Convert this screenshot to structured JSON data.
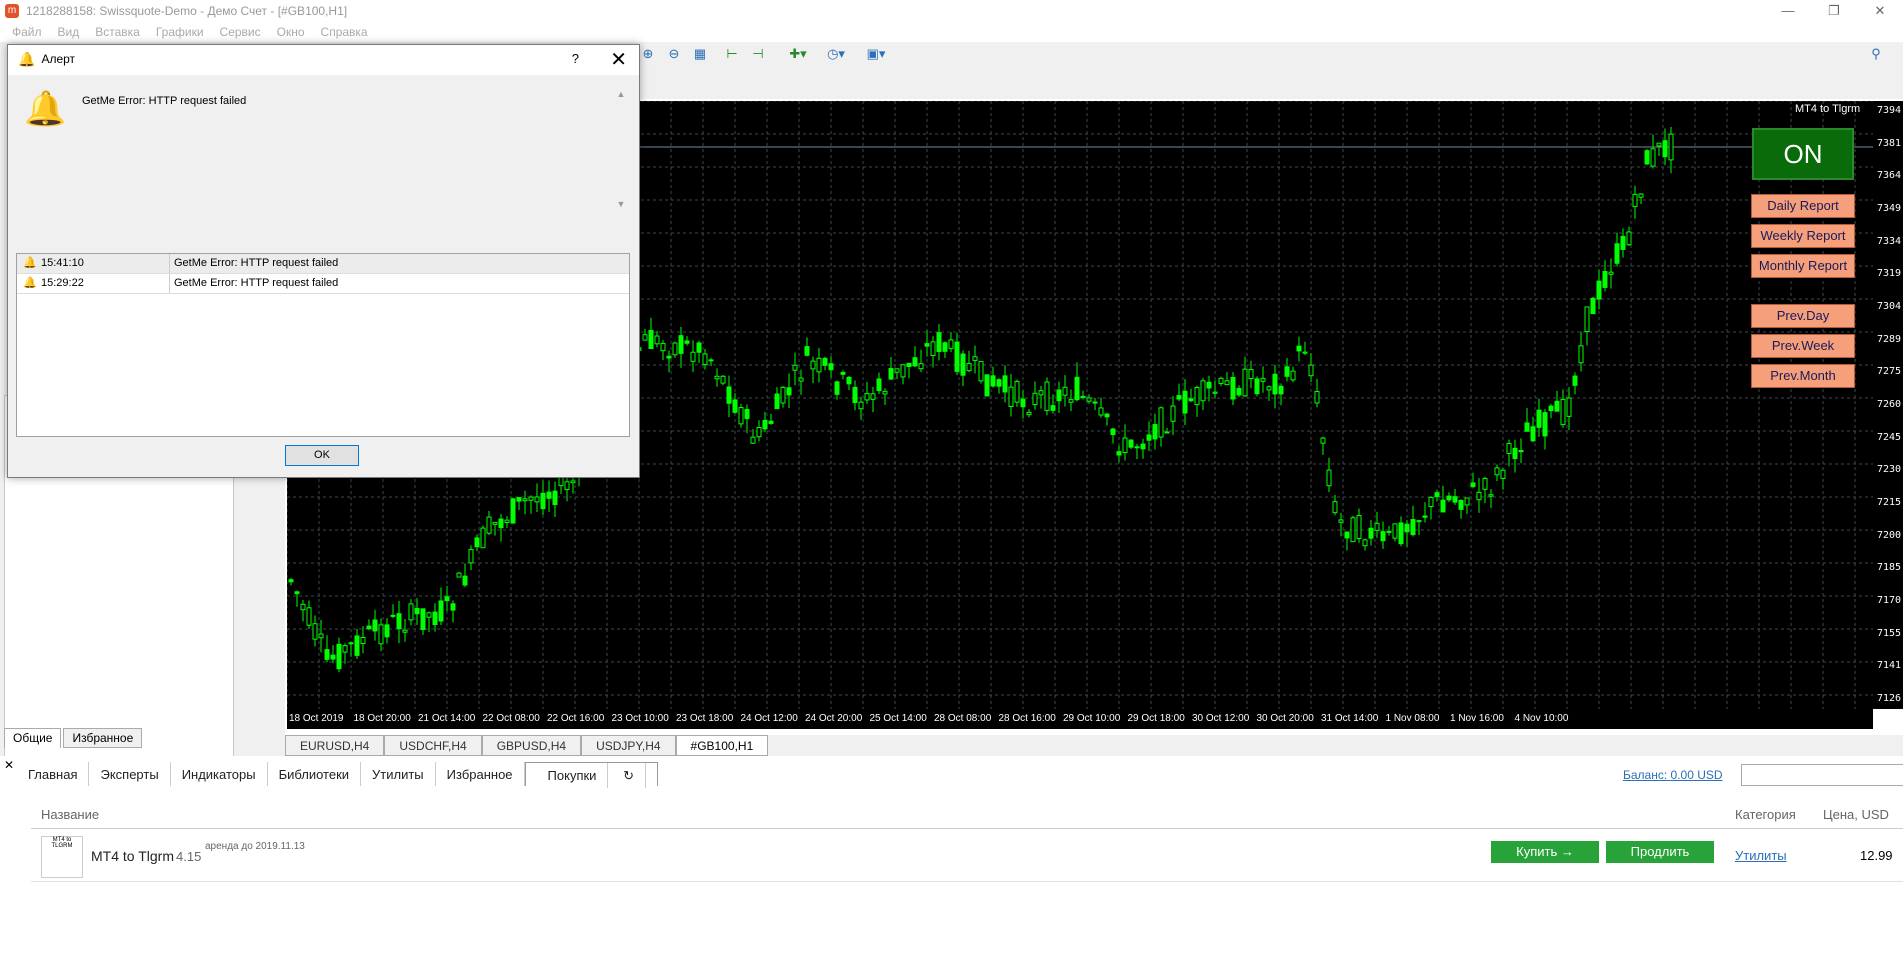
{
  "window": {
    "title": "1218288158: Swissquote-Demo - Демо Счет - [#GB100,H1]",
    "app_icon": "mt4-icon"
  },
  "menu": [
    "Файл",
    "Вид",
    "Вставка",
    "Графики",
    "Сервис",
    "Окно",
    "Справка"
  ],
  "navigator_tabs": [
    "Общие",
    "Избранное"
  ],
  "chart": {
    "ea_title": "MT4 to Tlgrm",
    "buttons": {
      "on": "ON",
      "daily": "Daily Report",
      "weekly": "Weekly Report",
      "monthly": "Monthly Report",
      "prev_day": "Prev.Day",
      "prev_week": "Prev.Week",
      "prev_month": "Prev.Month"
    },
    "price_labels": [
      "7394.3",
      "7381.2",
      "7364.0",
      "7349.0",
      "7334.0",
      "7319.0",
      "7304.0",
      "7289.0",
      "7275.0",
      "7260.0",
      "7245.0",
      "7230.0",
      "7215.0",
      "7200.0",
      "7185.0",
      "7170.0",
      "7155.0",
      "7141.0",
      "7126.0"
    ],
    "time_labels": [
      "18 Oct 2019",
      "18 Oct 20:00",
      "21 Oct 14:00",
      "22 Oct 08:00",
      "22 Oct 16:00",
      "23 Oct 10:00",
      "23 Oct 18:00",
      "24 Oct 12:00",
      "24 Oct 20:00",
      "25 Oct 14:00",
      "28 Oct 08:00",
      "28 Oct 16:00",
      "29 Oct 10:00",
      "29 Oct 18:00",
      "30 Oct 12:00",
      "30 Oct 20:00",
      "31 Oct 14:00",
      "1 Nov 08:00",
      "1 Nov 16:00",
      "4 Nov 10:00"
    ],
    "colors": {
      "background": "#000000",
      "candle": "#00ff00",
      "grid": "#3a4a4a"
    }
  },
  "chart_tabs": [
    "EURUSD,H4",
    "USDCHF,H4",
    "GBPUSD,H4",
    "USDJPY,H4",
    "#GB100,H1"
  ],
  "alert": {
    "title": "Алерт",
    "message": "GetMe Error: HTTP request failed",
    "rows": [
      {
        "time": "15:41:10",
        "message": "GetMe Error: HTTP request failed"
      },
      {
        "time": "15:29:22",
        "message": "GetMe Error: HTTP request failed"
      }
    ],
    "ok": "OK"
  },
  "market": {
    "tabs": [
      "Главная",
      "Эксперты",
      "Индикаторы",
      "Библиотеки",
      "Утилиты",
      "Избранное",
      "Покупки"
    ],
    "balance": "Баланс: 0.00 USD",
    "col_name": "Название",
    "col_category": "Категория",
    "col_price": "Цена, USD",
    "product": {
      "name": "MT4 to Tlgrm",
      "version": "4.15",
      "rent": "аренда до 2019.11.13",
      "buy": "Купить →",
      "renew": "Продлить",
      "category": "Утилиты",
      "price": "12.99",
      "icon_text": "MT4 to TLGRM"
    }
  }
}
